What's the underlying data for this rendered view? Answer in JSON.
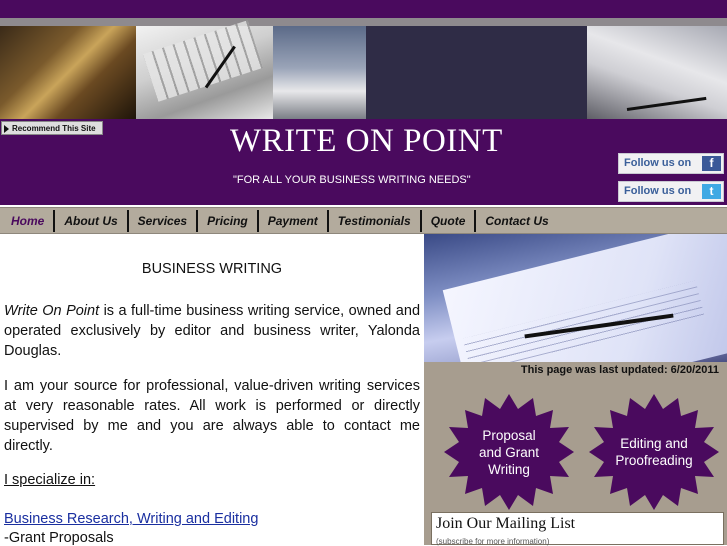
{
  "header": {
    "recommend_label": "Recommend This Site",
    "site_title": "WRITE ON POINT",
    "tagline": "\"FOR ALL YOUR BUSINESS WRITING NEEDS\"",
    "follow_facebook": "Follow us on",
    "follow_twitter": "Follow us on",
    "facebook_glyph": "f",
    "twitter_glyph": "t"
  },
  "nav": {
    "items": [
      {
        "label": "Home"
      },
      {
        "label": "About Us"
      },
      {
        "label": "Services"
      },
      {
        "label": "Pricing"
      },
      {
        "label": "Payment"
      },
      {
        "label": "Testimonials"
      },
      {
        "label": "Quote"
      },
      {
        "label": "Contact Us"
      }
    ],
    "active": "Home"
  },
  "main": {
    "heading": "BUSINESS WRITING",
    "intro_emphasis": "Write On Point",
    "intro_rest": " is a full-time business writing service, owned and operated exclusively by editor and business writer, Yalonda Douglas.",
    "paragraph2": "I am your source for professional, value-driven writing services at very reasonable rates.  All work is performed or directly supervised by me and you are always able to contact me directly.",
    "specialize": "I specialize in:",
    "service_link": "Business Research, Writing and Editing",
    "service_item": "-Grant Proposals"
  },
  "sidebar": {
    "last_updated": "This page was last updated: 6/20/2011",
    "badge1": {
      "line1": "Proposal",
      "line2": "and Grant",
      "line3": "Writing"
    },
    "badge2": {
      "line1": "Editing and",
      "line2": "Proofreading"
    },
    "mailing_title": "Join Our Mailing List",
    "mailing_sub": "(subscribe for more information)"
  },
  "colors": {
    "header_purple": "#4a0a5e",
    "nav_background": "#b3ab9d",
    "sidebar_background": "#a79d8f",
    "badge_fill": "#4a0a5e",
    "link_blue": "#1a2fa0"
  }
}
